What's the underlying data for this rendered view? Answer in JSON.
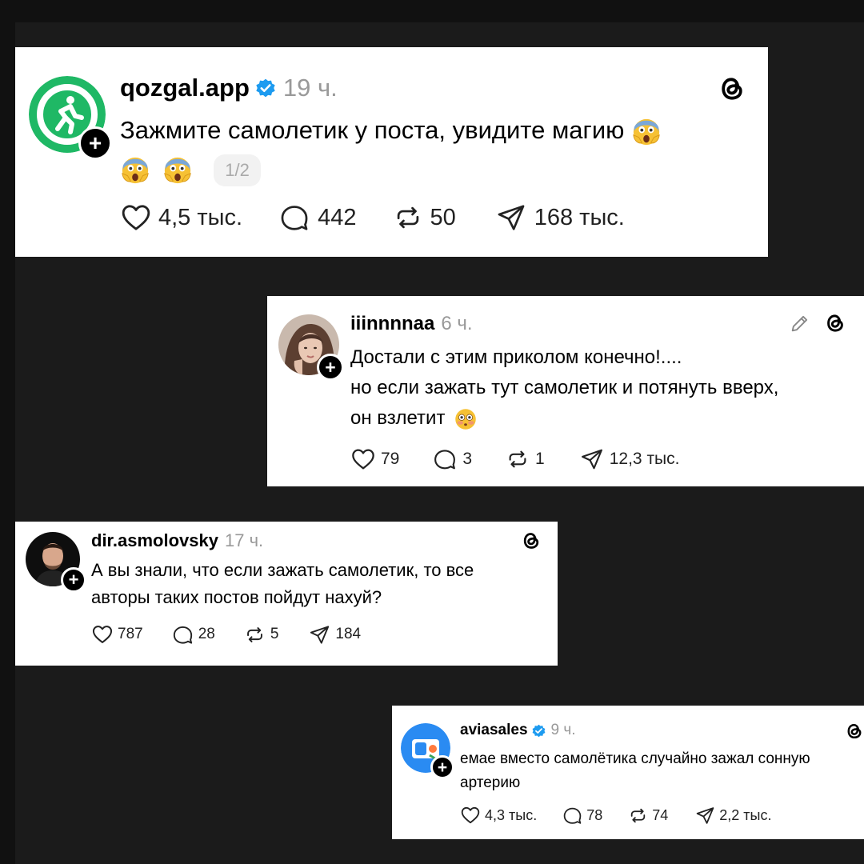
{
  "posts": [
    {
      "username": "qozgal.app",
      "verified": true,
      "time": "19 ч.",
      "text_lines": [
        "Зажмите самолетик у поста, увидите магию"
      ],
      "emoji_line": [
        "scream-emoji",
        "scream-emoji"
      ],
      "text_emoji": "scream-emoji",
      "pager": "1/2",
      "likes": "4,5 тыс.",
      "comments": "442",
      "reposts": "50",
      "shares": "168 тыс.",
      "avatar_color": "#1fb865"
    },
    {
      "username": "iiinnnnaa",
      "verified": false,
      "time": "6 ч.",
      "text_lines": [
        "Достали с этим приколом конечно!....",
        "но если зажать тут самолетик и потянуть вверх,",
        "он взлетит"
      ],
      "text_emoji": "flushed-emoji",
      "has_edit_icon": true,
      "likes": "79",
      "comments": "3",
      "reposts": "1",
      "shares": "12,3 тыс."
    },
    {
      "username": "dir.asmolovsky",
      "verified": false,
      "time": "17 ч.",
      "text_lines": [
        "А вы знали, что если зажать самолетик, то все",
        "авторы таких постов пойдут нахуй?"
      ],
      "likes": "787",
      "comments": "28",
      "reposts": "5",
      "shares": "184"
    },
    {
      "username": "aviasales",
      "verified": true,
      "time": "9 ч.",
      "text_lines": [
        "емае вместо самолётика случайно зажал сонную",
        "артерию"
      ],
      "likes": "4,3 тыс.",
      "comments": "78",
      "reposts": "74",
      "shares": "2,2 тыс.",
      "avatar_color": "#2a8bf2"
    }
  ],
  "colors": {
    "background": "#111111",
    "card": "#ffffff",
    "verified": "#1d9bf0",
    "muted": "#999999"
  }
}
